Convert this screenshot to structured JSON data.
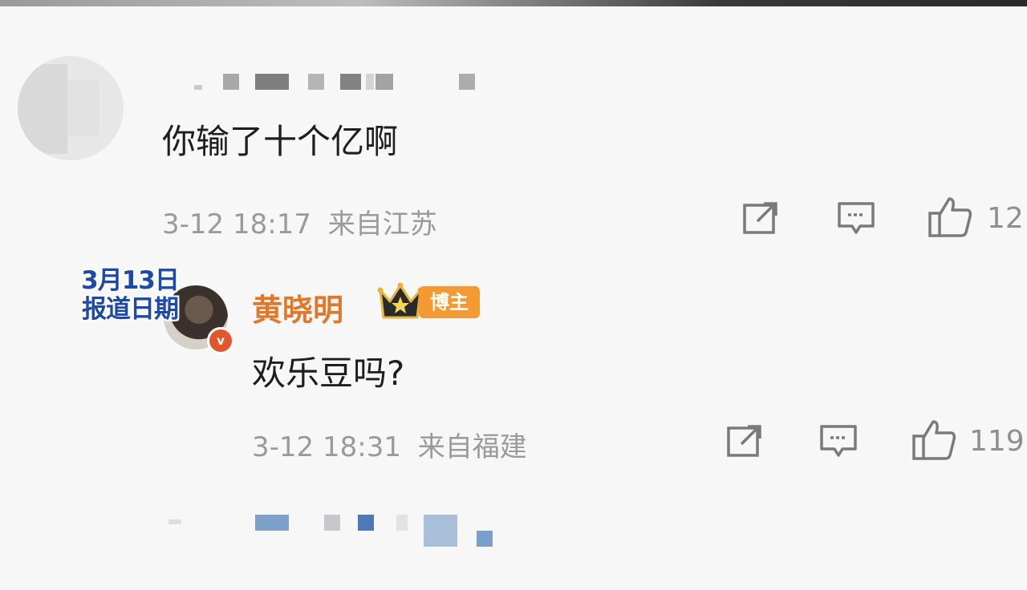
{
  "comments": [
    {
      "text": "你输了十个亿啊",
      "timestamp": "3-12 18:17",
      "location": "来自江苏",
      "like_count": "12"
    },
    {
      "author": "黄晓明",
      "author_badge": "博主",
      "text": "欢乐豆吗?",
      "timestamp": "3-12 18:31",
      "location": "来自福建",
      "like_count": "119"
    }
  ],
  "overlay": {
    "line1": "3月13日",
    "line2": "报道日期"
  },
  "icons": [
    "share-icon",
    "comment-icon",
    "like-icon",
    "crown-icon",
    "verified-icon"
  ],
  "colors": {
    "author_name": "#e0782a",
    "badge": "#f39a32",
    "verified": "#e1572b",
    "overlay_text": "#1d49a8"
  }
}
